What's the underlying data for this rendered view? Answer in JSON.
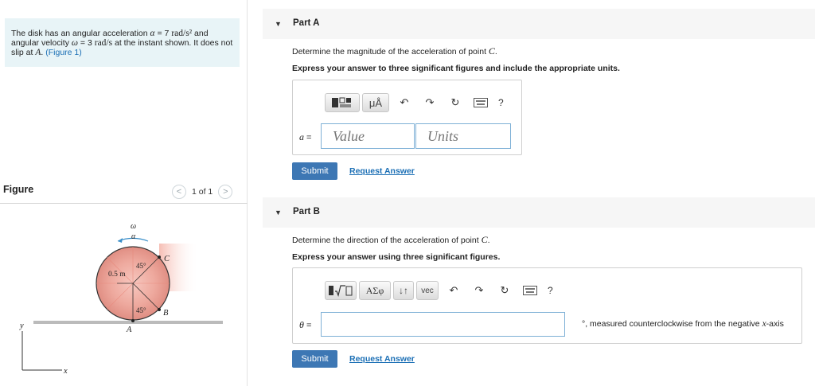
{
  "problem": {
    "part1": "The disk has an angular acceleration ",
    "alpha_sym": "α",
    "part2": " = 7 ",
    "alpha_unit": "rad/s²",
    "part3": " and angular velocity ",
    "omega_sym": "ω",
    "part4": " = 3 ",
    "omega_unit": "rad/s",
    "part5": " at the instant shown. It does not slip at ",
    "point": "A",
    "part6": ". ",
    "figure_link": "(Figure 1)"
  },
  "figure_panel": {
    "title": "Figure",
    "prev": "<",
    "page": "1 of 1",
    "next": ">"
  },
  "figure": {
    "omega": "ω",
    "alpha": "α",
    "radius": "0.5 m",
    "angle_top": "45°",
    "angle_bottom": "45°",
    "point_c": "C",
    "point_b": "B",
    "point_a": "A",
    "axis_y": "y",
    "axis_x": "x"
  },
  "part_a": {
    "title": "Part A",
    "question_prefix": "Determine the magnitude of the acceleration of point ",
    "question_point": "C",
    "question_suffix": ".",
    "instruction": "Express your answer to three significant figures and include the appropriate units.",
    "var": "a",
    "eq": " =",
    "value_placeholder": "Value",
    "units_placeholder": "Units",
    "toolbar_unit_label": "μÅ",
    "submit": "Submit",
    "request": "Request Answer"
  },
  "part_b": {
    "title": "Part B",
    "question_prefix": "Determine the direction of the acceleration of point ",
    "question_point": "C",
    "question_suffix": ".",
    "instruction": "Express your answer using three significant figures.",
    "var": "θ",
    "eq": " =",
    "greek_label": "ΑΣφ",
    "vec_label": "vec",
    "suffix_prefix": "°, measured counterclockwise from the negative ",
    "suffix_axis": "x",
    "suffix_end": "-axis",
    "submit": "Submit",
    "request": "Request Answer"
  },
  "toolbar": {
    "help": "?"
  }
}
